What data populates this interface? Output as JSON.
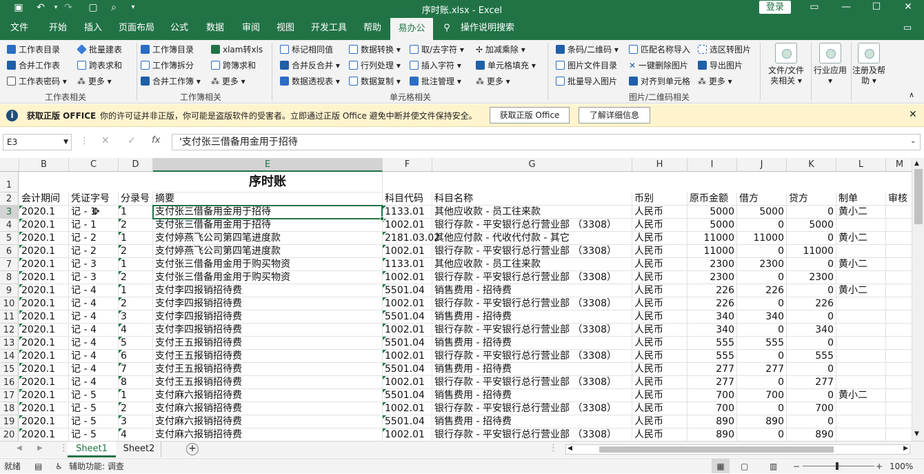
{
  "titlebar": {
    "title": "序时账.xlsx  -  Excel",
    "login": "登录"
  },
  "tabs": [
    "文件",
    "开始",
    "插入",
    "页面布局",
    "公式",
    "数据",
    "审阅",
    "视图",
    "开发工具",
    "帮助",
    "易办公",
    "操作说明搜索"
  ],
  "ribbon": {
    "g1": [
      "工作表目录",
      "批量建表",
      "合并工作表",
      "跨表求和",
      "工作表密码",
      "更多"
    ],
    "g2": [
      "工作簿目录",
      "xlam转xls",
      "工作簿拆分",
      "跨簿求和",
      "合并工作簿",
      "更多"
    ],
    "g3": [
      "标记相同值",
      "数据转换",
      "取/去字符",
      "加减乘除",
      "合并反合并",
      "行列处理",
      "插入字符",
      "单元格填充",
      "数据透视表",
      "数据复制",
      "批注管理",
      "更多"
    ],
    "g4": [
      "条码/二维码",
      "匹配名称导入",
      "选区转图片",
      "图片文件目录",
      "一键删除图片",
      "导出图片",
      "批量导入图片",
      "对齐到单元格",
      "更多"
    ],
    "big": [
      "文件/文件夹相关",
      "行业应用",
      "注册及帮助"
    ],
    "group_labels": [
      "工作表相关",
      "工作簿相关",
      "单元格相关",
      "图片/二维码相关"
    ]
  },
  "msgbar": {
    "title": "获取正版 OFFICE",
    "text": "你的许可证并非正版，你可能是盗版软件的受害者。立即通过正版 Office 避免中断并使文件保持安全。",
    "btn1": "获取正版 Office",
    "btn2": "了解详细信息"
  },
  "formula": {
    "namebox": "E3",
    "fx": "fx",
    "content": "'支付张三借备用金用于招待"
  },
  "columns": [
    "B",
    "C",
    "D",
    "E",
    "F",
    "G",
    "H",
    "I",
    "J",
    "K",
    "L",
    "M"
  ],
  "sheet_title": "序时账",
  "headers": [
    "会计期间",
    "凭证字号",
    "分录号",
    "摘要",
    "科目代码",
    "科目名称",
    "币别",
    "原币金额",
    "借方",
    "贷方",
    "制单",
    "审核"
  ],
  "rows": [
    [
      "3",
      "2020.1",
      "记 - 1",
      "1",
      "支付张三借备用金用于招待",
      "1133.01",
      "其他应收款 - 员工往来款",
      "人民币",
      "5000",
      "5000",
      "0",
      "黄小二"
    ],
    [
      "4",
      "2020.1",
      "记 - 1",
      "2",
      "支付张三借备用金用于招待",
      "1002.01",
      "银行存款 - 平安银行总行营业部 （3308）",
      "人民币",
      "5000",
      "0",
      "5000",
      ""
    ],
    [
      "5",
      "2020.1",
      "记 - 2",
      "1",
      "支付婷燕飞公司第四笔进度款",
      "2181.03.02",
      "其他应付款 - 代收代付款 - 其它",
      "人民币",
      "11000",
      "11000",
      "0",
      "黄小二"
    ],
    [
      "6",
      "2020.1",
      "记 - 2",
      "2",
      "支付婷燕飞公司第四笔进度款",
      "1002.01",
      "银行存款 - 平安银行总行营业部 （3308）",
      "人民币",
      "11000",
      "0",
      "11000",
      ""
    ],
    [
      "7",
      "2020.1",
      "记 - 3",
      "1",
      "支付张三借备用金用于购买物资",
      "1133.01",
      "其他应收款 - 员工往来款",
      "人民币",
      "2300",
      "2300",
      "0",
      "黄小二"
    ],
    [
      "8",
      "2020.1",
      "记 - 3",
      "2",
      "支付张三借备用金用于购买物资",
      "1002.01",
      "银行存款 - 平安银行总行营业部 （3308）",
      "人民币",
      "2300",
      "0",
      "2300",
      ""
    ],
    [
      "9",
      "2020.1",
      "记 - 4",
      "1",
      "支付李四报销招待费",
      "5501.04",
      "销售费用 - 招待费",
      "人民币",
      "226",
      "226",
      "0",
      "黄小二"
    ],
    [
      "10",
      "2020.1",
      "记 - 4",
      "2",
      "支付李四报销招待费",
      "1002.01",
      "银行存款 - 平安银行总行营业部 （3308）",
      "人民币",
      "226",
      "0",
      "226",
      ""
    ],
    [
      "11",
      "2020.1",
      "记 - 4",
      "3",
      "支付李四报销招待费",
      "5501.04",
      "销售费用 - 招待费",
      "人民币",
      "340",
      "340",
      "0",
      ""
    ],
    [
      "12",
      "2020.1",
      "记 - 4",
      "4",
      "支付李四报销招待费",
      "1002.01",
      "银行存款 - 平安银行总行营业部 （3308）",
      "人民币",
      "340",
      "0",
      "340",
      ""
    ],
    [
      "13",
      "2020.1",
      "记 - 4",
      "5",
      "支付王五报销招待费",
      "5501.04",
      "销售费用 - 招待费",
      "人民币",
      "555",
      "555",
      "0",
      ""
    ],
    [
      "14",
      "2020.1",
      "记 - 4",
      "6",
      "支付王五报销招待费",
      "1002.01",
      "银行存款 - 平安银行总行营业部 （3308）",
      "人民币",
      "555",
      "0",
      "555",
      ""
    ],
    [
      "15",
      "2020.1",
      "记 - 4",
      "7",
      "支付王五报销招待费",
      "5501.04",
      "销售费用 - 招待费",
      "人民币",
      "277",
      "277",
      "0",
      ""
    ],
    [
      "16",
      "2020.1",
      "记 - 4",
      "8",
      "支付王五报销招待费",
      "1002.01",
      "银行存款 - 平安银行总行营业部 （3308）",
      "人民币",
      "277",
      "0",
      "277",
      ""
    ],
    [
      "17",
      "2020.1",
      "记 - 5",
      "1",
      "支付麻六报销招待费",
      "5501.04",
      "销售费用 - 招待费",
      "人民币",
      "700",
      "700",
      "0",
      "黄小二"
    ],
    [
      "18",
      "2020.1",
      "记 - 5",
      "2",
      "支付麻六报销招待费",
      "1002.01",
      "银行存款 - 平安银行总行营业部 （3308）",
      "人民币",
      "700",
      "0",
      "700",
      ""
    ],
    [
      "19",
      "2020.1",
      "记 - 5",
      "3",
      "支付麻六报销招待费",
      "5501.04",
      "销售费用 - 招待费",
      "人民币",
      "890",
      "890",
      "0",
      ""
    ],
    [
      "20",
      "2020.1",
      "记 - 5",
      "4",
      "支付麻六报销招待费",
      "1002.01",
      "银行存款 - 平安银行总行营业部 （3308）",
      "人民币",
      "890",
      "0",
      "890",
      ""
    ]
  ],
  "sheets": [
    "Sheet1",
    "Sheet2"
  ],
  "status": {
    "ready": "就绪",
    "accessibility": "辅助功能: 调查",
    "zoom": "100%"
  }
}
